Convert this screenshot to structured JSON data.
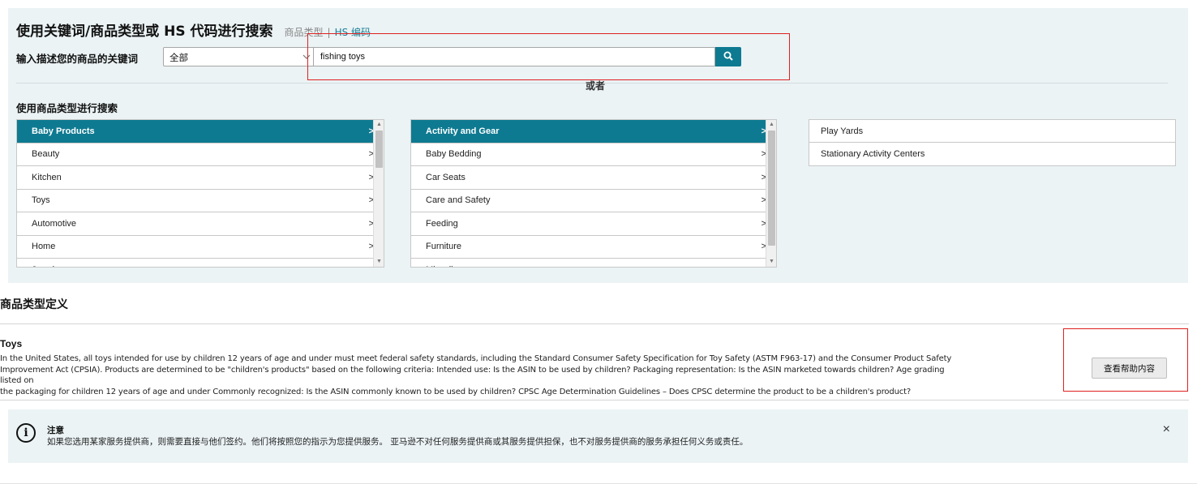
{
  "search": {
    "heading": "使用关键词/商品类型或 HS 代码进行搜索",
    "mode_product_type": "商品类型",
    "mode_separator": "|",
    "mode_hs_code": "HS 编码",
    "keyword_label": "输入描述您的商品的关键词",
    "category_select_value": "全部",
    "query": "fishing toys",
    "or_text": "或者"
  },
  "browse": {
    "title": "使用商品类型进行搜索",
    "level1": [
      {
        "label": "Baby Products",
        "selected": true
      },
      {
        "label": "Beauty"
      },
      {
        "label": "Kitchen"
      },
      {
        "label": "Toys"
      },
      {
        "label": "Automotive"
      },
      {
        "label": "Home"
      },
      {
        "label": "Jewelry"
      }
    ],
    "level2": [
      {
        "label": "Activity and Gear",
        "selected": true
      },
      {
        "label": "Baby Bedding"
      },
      {
        "label": "Car Seats"
      },
      {
        "label": "Care and Safety"
      },
      {
        "label": "Feeding"
      },
      {
        "label": "Furniture"
      },
      {
        "label": "Miscellaneous"
      }
    ],
    "level3": [
      {
        "label": "Play Yards"
      },
      {
        "label": "Stationary Activity Centers"
      }
    ],
    "chevron": ">"
  },
  "definition": {
    "title": "商品类型定义",
    "subtitle": "Toys",
    "line1": "In the United States, all toys intended for use by children 12 years of age and under must meet federal safety standards, including the Standard Consumer Safety Specification for Toy Safety (ASTM F963-17) and the Consumer Product Safety",
    "line2": "Improvement Act (CPSIA). Products are determined to be \"children's products\" based on the following criteria: Intended use: Is the ASIN to be used by children? Packaging representation: Is the ASIN marketed towards children? Age grading listed on",
    "line3": "the packaging for children 12 years of age and under Commonly recognized: Is the ASIN commonly known to be used by children? CPSC Age Determination Guidelines – Does CPSC determine the product to be a children's product?",
    "help_button": "查看帮助内容"
  },
  "notice": {
    "icon_text": "i",
    "title": "注意",
    "text": "如果您选用某家服务提供商，则需要直接与他们签约。他们将按照您的指示为您提供服务。 亚马逊不对任何服务提供商或其服务提供担保，也不对服务提供商的服务承担任何义务或责任。",
    "close": "×"
  },
  "colors": {
    "accent": "#0e7a91",
    "panel_bg": "#ebf3f5",
    "highlight_box": "#e02020"
  }
}
